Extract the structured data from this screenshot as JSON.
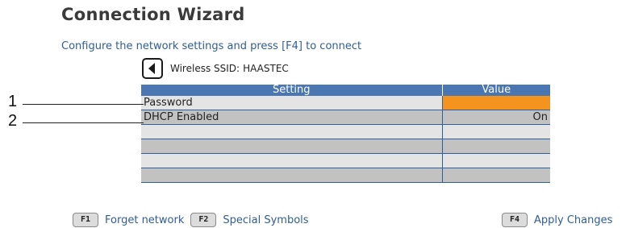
{
  "wizard": {
    "title": "Connection Wizard",
    "subtitle": "Configure the network settings and press [F4] to connect",
    "ssid_label": "Wireless SSID:",
    "ssid_value": "HAASTEC",
    "back_icon": "left-arrow-icon"
  },
  "table": {
    "headers": [
      "Setting",
      "Value"
    ],
    "rows": [
      {
        "setting": "Password",
        "value": ""
      },
      {
        "setting": "DHCP Enabled",
        "value": "On"
      },
      {
        "setting": "",
        "value": ""
      },
      {
        "setting": "",
        "value": ""
      },
      {
        "setting": "",
        "value": ""
      },
      {
        "setting": "",
        "value": ""
      }
    ]
  },
  "callouts": [
    "1",
    "2"
  ],
  "footer": {
    "f1_key": "F1",
    "f1_label": "Forget network",
    "f2_key": "F2",
    "f2_label": "Special Symbols",
    "f4_key": "F4",
    "f4_label": "Apply Changes"
  },
  "colors": {
    "header_blue": "#4a77b2",
    "text_blue": "#2f5c9a",
    "highlight_orange": "#f5931f",
    "row_light": "#e4e4e4",
    "row_dark": "#c2c2c2"
  }
}
